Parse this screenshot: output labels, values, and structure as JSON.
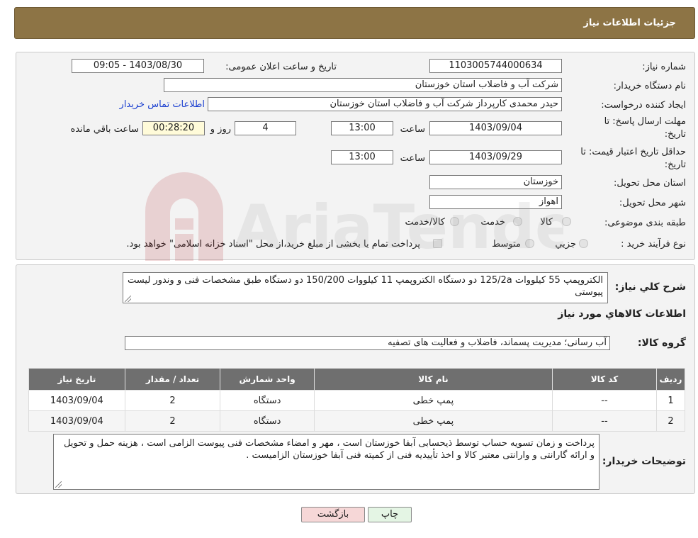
{
  "header": {
    "title": "جزئیات اطلاعات نیاز"
  },
  "form": {
    "need_number_label": "شماره نیاز:",
    "need_number": "1103005744000634",
    "announce_label": "تاریخ و ساعت اعلان عمومی:",
    "announce_value": "1403/08/30 - 09:05",
    "buyer_org_label": "نام دستگاه خریدار:",
    "buyer_org": "شرکت آب و فاضلاب استان خوزستان",
    "creator_label": "ایجاد کننده درخواست:",
    "creator": "حیدر محمدی کارپرداز شرکت آب و فاضلاب استان خوزستان",
    "contact_link": "اطلاعات تماس خریدار",
    "deadline_label_line1": "مهلت ارسال پاسخ: تا",
    "deadline_label_line2": "تاریخ:",
    "deadline_date": "1403/09/04",
    "time_label": "ساعت",
    "deadline_time": "13:00",
    "days_value": "4",
    "days_label": "روز و",
    "remaining_time": "00:28:20",
    "remaining_label": "ساعت باقي مانده",
    "price_validity_label_line1": "حداقل تاریخ اعتبار قیمت: تا",
    "price_validity_label_line2": "تاریخ:",
    "price_validity_date": "1403/09/29",
    "price_validity_time": "13:00",
    "province_label": "استان محل تحویل:",
    "province": "خوزستان",
    "city_label": "شهر محل تحویل:",
    "city": "اهواز",
    "category_label": "طبقه بندی موضوعی:",
    "category_options": [
      "کالا",
      "خدمت",
      "کالا/خدمت"
    ],
    "purchase_type_label": "نوع فرآیند خرید :",
    "purchase_options": [
      "جزيي",
      "متوسط"
    ],
    "purchase_note": "پرداخت تمام یا بخشی از مبلغ خرید،از محل \"اسناد خزانه اسلامی\" خواهد بود."
  },
  "description": {
    "label": "شرح کلي نياز:",
    "text": "الکتروپمپ 55 کیلووات 125/2a دو دستگاه الکتروپمپ 11 کیلووات 150/200 دو دستگاه طبق مشخصات فنی و وندور لیست پیوستی",
    "items_title": "اطلاعات کالاهاي مورد نياز",
    "group_label": "گروه کالا:",
    "group_value": "آب رسانی؛ مدیریت پسماند، فاضلاب و فعالیت های تصفیه"
  },
  "table": {
    "headers": [
      "ردیف",
      "کد کالا",
      "نام کالا",
      "واحد شمارش",
      "تعداد / مقدار",
      "تاریخ نیاز"
    ],
    "rows": [
      [
        "1",
        "--",
        "پمپ خطی",
        "دستگاه",
        "2",
        "1403/09/04"
      ],
      [
        "2",
        "--",
        "پمپ خطی",
        "دستگاه",
        "2",
        "1403/09/04"
      ]
    ]
  },
  "buyer_notes": {
    "label": "توضیحات خریدار:",
    "text": "پرداخت و زمان تسویه حساب توسط ذیحسابی آبفا خوزستان است ، مهر و امضاء مشخصات فنی پیوست الزامی است ، هزینه حمل و تحویل و ارائه گارانتی و وارانتی معتبر کالا و اخذ تأییدیه فنی از کمیته فنی آبفا خوزستان الزامیست ."
  },
  "buttons": {
    "print": "چاپ",
    "back": "بازگشت"
  },
  "watermark": {
    "text": "AriaTender.neT"
  },
  "colors": {
    "header": "#8d7445",
    "back_button": "#f6d7d7",
    "print_button": "#e4f5e4",
    "link": "#1a3fd0"
  }
}
